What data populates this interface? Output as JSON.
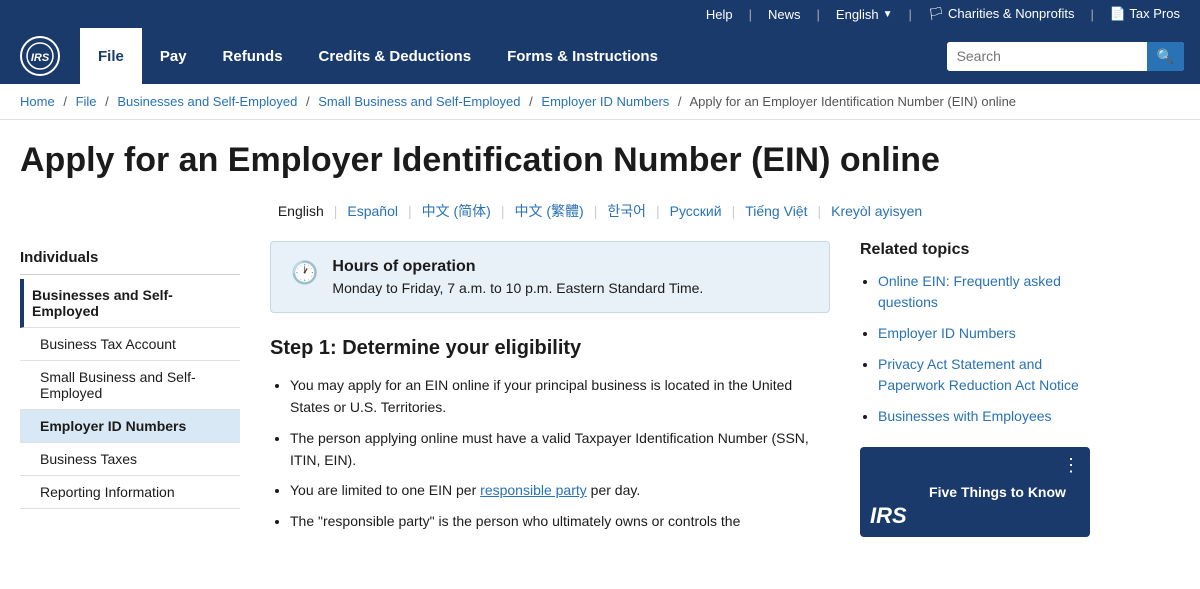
{
  "top_bar": {
    "help": "Help",
    "news": "News",
    "language": "English",
    "charities": "Charities & Nonprofits",
    "tax_pros": "Tax Pros"
  },
  "nav": {
    "logo_text": "IRS",
    "items": [
      {
        "label": "File",
        "active": true
      },
      {
        "label": "Pay",
        "active": false
      },
      {
        "label": "Refunds",
        "active": false
      },
      {
        "label": "Credits & Deductions",
        "active": false
      },
      {
        "label": "Forms & Instructions",
        "active": false
      }
    ],
    "search_placeholder": "Search"
  },
  "breadcrumb": {
    "items": [
      {
        "label": "Home",
        "href": "#"
      },
      {
        "label": "File",
        "href": "#"
      },
      {
        "label": "Businesses and Self-Employed",
        "href": "#"
      },
      {
        "label": "Small Business and Self-Employed",
        "href": "#"
      },
      {
        "label": "Employer ID Numbers",
        "href": "#"
      },
      {
        "label": "Apply for an Employer Identification Number (EIN) online",
        "href": null
      }
    ]
  },
  "page": {
    "title": "Apply for an Employer Identification Number (EIN) online",
    "languages": [
      {
        "label": "English",
        "link": false
      },
      {
        "label": "Español",
        "link": true
      },
      {
        "label": "中文 (简体)",
        "link": true
      },
      {
        "label": "中文 (繁體)",
        "link": true
      },
      {
        "label": "한국어",
        "link": true
      },
      {
        "label": "Русский",
        "link": true
      },
      {
        "label": "Tiếng Việt",
        "link": true
      },
      {
        "label": "Kreyòl ayisyen",
        "link": true
      }
    ]
  },
  "sidebar": {
    "section_title": "Individuals",
    "items": [
      {
        "label": "Businesses and Self-Employed",
        "type": "section-header"
      },
      {
        "label": "Business Tax Account",
        "type": "subitem"
      },
      {
        "label": "Small Business and Self-Employed",
        "type": "subitem"
      },
      {
        "label": "Employer ID Numbers",
        "type": "subitem",
        "active": true
      },
      {
        "label": "Business Taxes",
        "type": "subitem"
      },
      {
        "label": "Reporting Information",
        "type": "subitem"
      }
    ]
  },
  "hours_box": {
    "title": "Hours of operation",
    "text": "Monday to Friday, 7 a.m. to 10 p.m. Eastern Standard Time."
  },
  "step1": {
    "title": "Step 1: Determine your eligibility",
    "bullets": [
      "You may apply for an EIN online if your principal business is located in the United States or U.S. Territories.",
      "The person applying online must have a valid Taxpayer Identification Number (SSN, ITIN, EIN).",
      "You are limited to one EIN per <a href='#' style='color:#2872b5'>responsible party</a> per day.",
      "The \"responsible party\" is the person who ultimately owns or controls the"
    ]
  },
  "related_topics": {
    "title": "Related topics",
    "items": [
      {
        "label": "Online EIN: Frequently asked questions",
        "href": "#"
      },
      {
        "label": "Employer ID Numbers",
        "href": "#"
      },
      {
        "label": "Privacy Act Statement and Paperwork Reduction Act Notice",
        "href": "#"
      },
      {
        "label": "Businesses with Employees",
        "href": "#"
      }
    ]
  },
  "video": {
    "logo": "IRS",
    "title": "Five Things to Know"
  }
}
